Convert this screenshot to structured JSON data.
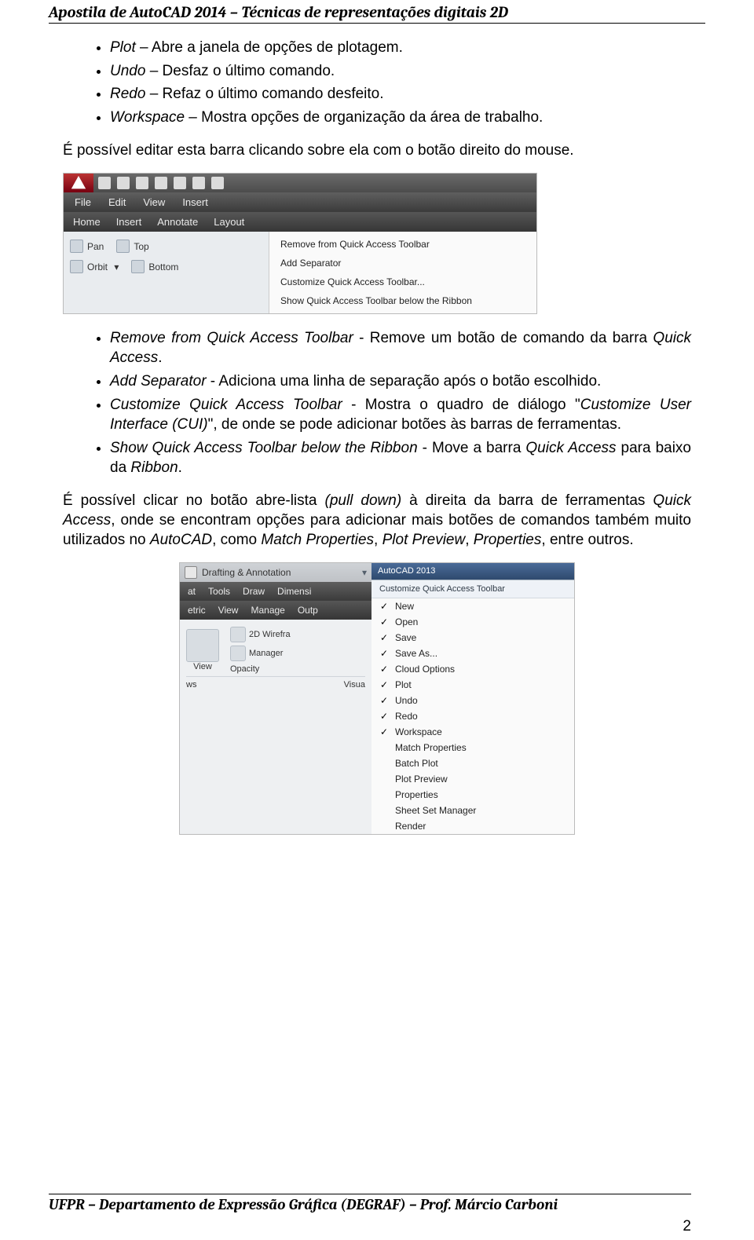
{
  "header": {
    "title": "Apostila de AutoCAD 2014 – Técnicas de representações digitais 2D"
  },
  "list1": [
    {
      "term": "Plot",
      "text": " – Abre a janela de opções de plotagem."
    },
    {
      "term": "Undo",
      "text": " – Desfaz o último comando."
    },
    {
      "term": "Redo",
      "text": " – Refaz o último comando desfeito."
    },
    {
      "term": "Workspace",
      "text": " – Mostra opções de organização da área de trabalho."
    }
  ],
  "para1": "É possível editar esta barra clicando sobre ela com o botão direito do mouse.",
  "shot1": {
    "menubar": [
      "File",
      "Edit",
      "View",
      "Insert"
    ],
    "tabbar": [
      "Home",
      "Insert",
      "Annotate",
      "Layout"
    ],
    "toolpanel": {
      "row1": [
        {
          "label": "Pan"
        },
        {
          "label": "Top"
        }
      ],
      "row2": [
        {
          "label": "Orbit"
        },
        {
          "label": "Bottom"
        }
      ]
    },
    "contextMenu": [
      "Remove from Quick Access Toolbar",
      "Add Separator",
      "Customize Quick Access Toolbar...",
      "Show Quick Access Toolbar below the Ribbon"
    ]
  },
  "list2": [
    {
      "term": "Remove from Quick Access Toolbar",
      "text": " - Remove um botão de comando da barra ",
      "term2": "Quick Access",
      "tail": "."
    },
    {
      "term": "Add Separator",
      "text": " - Adiciona uma linha de separação após o botão escolhido."
    },
    {
      "term": "Customize Quick Access Toolbar",
      "text": " - Mostra o quadro de diálogo \"",
      "term2": "Customize User Interface (CUI)",
      "tail": "\", de onde se pode adicionar botões às barras de ferramentas."
    },
    {
      "term": "Show Quick Access Toolbar below the Ribbon",
      "text": " - Move a barra ",
      "term2": "Quick Access",
      "tail": " para baixo da ",
      "term3": "Ribbon",
      "tail2": "."
    }
  ],
  "para2_a": "É possível clicar no botão abre-lista ",
  "para2_i1": "(pull down)",
  "para2_b": " à direita da barra de ferramentas ",
  "para2_i2": "Quick Access",
  "para2_c": ", onde se encontram opções para adicionar mais botões de comandos também muito utilizados no ",
  "para2_i3": "AutoCAD",
  "para2_d": ", como ",
  "para2_i4": "Match Properties",
  "para2_e": ", ",
  "para2_i5": "Plot Preview",
  "para2_f": ", ",
  "para2_i6": "Properties",
  "para2_g": ", entre outros.",
  "shot2": {
    "workspace": "Drafting & Annotation",
    "apptitle": "AutoCAD 2013",
    "menubar": [
      "at",
      "Tools",
      "Draw",
      "Dimensi"
    ],
    "tabbar": [
      "etric",
      "View",
      "Manage",
      "Outp"
    ],
    "rib": {
      "c1a": "2D Wirefra",
      "c1b": "View",
      "c2a": "Manager",
      "c2b": "Opacity",
      "c3": "Visua",
      "c4": "ws"
    },
    "ddHeader": "Customize Quick Access Toolbar",
    "items": [
      {
        "chk": true,
        "label": "New"
      },
      {
        "chk": true,
        "label": "Open"
      },
      {
        "chk": true,
        "label": "Save"
      },
      {
        "chk": true,
        "label": "Save As..."
      },
      {
        "chk": true,
        "label": "Cloud Options"
      },
      {
        "chk": true,
        "label": "Plot"
      },
      {
        "chk": true,
        "label": "Undo"
      },
      {
        "chk": true,
        "label": "Redo"
      },
      {
        "chk": true,
        "label": "Workspace"
      },
      {
        "chk": false,
        "label": "Match Properties"
      },
      {
        "chk": false,
        "label": "Batch Plot"
      },
      {
        "chk": false,
        "label": "Plot Preview"
      },
      {
        "chk": false,
        "label": "Properties"
      },
      {
        "chk": false,
        "label": "Sheet Set Manager"
      },
      {
        "chk": false,
        "label": "Render"
      }
    ]
  },
  "footer": {
    "text": "UFPR – Departamento de Expressão Gráfica (DEGRAF) – Prof. Márcio Carboni",
    "page": "2"
  }
}
